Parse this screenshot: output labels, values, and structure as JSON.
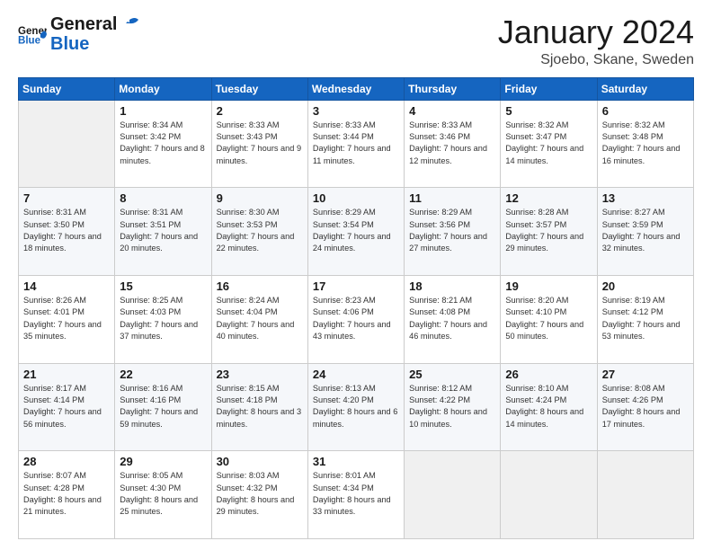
{
  "header": {
    "logo_line1": "General",
    "logo_line2": "Blue",
    "title": "January 2024",
    "subtitle": "Sjoebo, Skane, Sweden"
  },
  "days_of_week": [
    "Sunday",
    "Monday",
    "Tuesday",
    "Wednesday",
    "Thursday",
    "Friday",
    "Saturday"
  ],
  "weeks": [
    [
      {
        "num": "",
        "empty": true
      },
      {
        "num": "1",
        "sunrise": "8:34 AM",
        "sunset": "3:42 PM",
        "daylight": "7 hours and 8 minutes."
      },
      {
        "num": "2",
        "sunrise": "8:33 AM",
        "sunset": "3:43 PM",
        "daylight": "7 hours and 9 minutes."
      },
      {
        "num": "3",
        "sunrise": "8:33 AM",
        "sunset": "3:44 PM",
        "daylight": "7 hours and 11 minutes."
      },
      {
        "num": "4",
        "sunrise": "8:33 AM",
        "sunset": "3:46 PM",
        "daylight": "7 hours and 12 minutes."
      },
      {
        "num": "5",
        "sunrise": "8:32 AM",
        "sunset": "3:47 PM",
        "daylight": "7 hours and 14 minutes."
      },
      {
        "num": "6",
        "sunrise": "8:32 AM",
        "sunset": "3:48 PM",
        "daylight": "7 hours and 16 minutes."
      }
    ],
    [
      {
        "num": "7",
        "sunrise": "8:31 AM",
        "sunset": "3:50 PM",
        "daylight": "7 hours and 18 minutes."
      },
      {
        "num": "8",
        "sunrise": "8:31 AM",
        "sunset": "3:51 PM",
        "daylight": "7 hours and 20 minutes."
      },
      {
        "num": "9",
        "sunrise": "8:30 AM",
        "sunset": "3:53 PM",
        "daylight": "7 hours and 22 minutes."
      },
      {
        "num": "10",
        "sunrise": "8:29 AM",
        "sunset": "3:54 PM",
        "daylight": "7 hours and 24 minutes."
      },
      {
        "num": "11",
        "sunrise": "8:29 AM",
        "sunset": "3:56 PM",
        "daylight": "7 hours and 27 minutes."
      },
      {
        "num": "12",
        "sunrise": "8:28 AM",
        "sunset": "3:57 PM",
        "daylight": "7 hours and 29 minutes."
      },
      {
        "num": "13",
        "sunrise": "8:27 AM",
        "sunset": "3:59 PM",
        "daylight": "7 hours and 32 minutes."
      }
    ],
    [
      {
        "num": "14",
        "sunrise": "8:26 AM",
        "sunset": "4:01 PM",
        "daylight": "7 hours and 35 minutes."
      },
      {
        "num": "15",
        "sunrise": "8:25 AM",
        "sunset": "4:03 PM",
        "daylight": "7 hours and 37 minutes."
      },
      {
        "num": "16",
        "sunrise": "8:24 AM",
        "sunset": "4:04 PM",
        "daylight": "7 hours and 40 minutes."
      },
      {
        "num": "17",
        "sunrise": "8:23 AM",
        "sunset": "4:06 PM",
        "daylight": "7 hours and 43 minutes."
      },
      {
        "num": "18",
        "sunrise": "8:21 AM",
        "sunset": "4:08 PM",
        "daylight": "7 hours and 46 minutes."
      },
      {
        "num": "19",
        "sunrise": "8:20 AM",
        "sunset": "4:10 PM",
        "daylight": "7 hours and 50 minutes."
      },
      {
        "num": "20",
        "sunrise": "8:19 AM",
        "sunset": "4:12 PM",
        "daylight": "7 hours and 53 minutes."
      }
    ],
    [
      {
        "num": "21",
        "sunrise": "8:17 AM",
        "sunset": "4:14 PM",
        "daylight": "7 hours and 56 minutes."
      },
      {
        "num": "22",
        "sunrise": "8:16 AM",
        "sunset": "4:16 PM",
        "daylight": "7 hours and 59 minutes."
      },
      {
        "num": "23",
        "sunrise": "8:15 AM",
        "sunset": "4:18 PM",
        "daylight": "8 hours and 3 minutes."
      },
      {
        "num": "24",
        "sunrise": "8:13 AM",
        "sunset": "4:20 PM",
        "daylight": "8 hours and 6 minutes."
      },
      {
        "num": "25",
        "sunrise": "8:12 AM",
        "sunset": "4:22 PM",
        "daylight": "8 hours and 10 minutes."
      },
      {
        "num": "26",
        "sunrise": "8:10 AM",
        "sunset": "4:24 PM",
        "daylight": "8 hours and 14 minutes."
      },
      {
        "num": "27",
        "sunrise": "8:08 AM",
        "sunset": "4:26 PM",
        "daylight": "8 hours and 17 minutes."
      }
    ],
    [
      {
        "num": "28",
        "sunrise": "8:07 AM",
        "sunset": "4:28 PM",
        "daylight": "8 hours and 21 minutes."
      },
      {
        "num": "29",
        "sunrise": "8:05 AM",
        "sunset": "4:30 PM",
        "daylight": "8 hours and 25 minutes."
      },
      {
        "num": "30",
        "sunrise": "8:03 AM",
        "sunset": "4:32 PM",
        "daylight": "8 hours and 29 minutes."
      },
      {
        "num": "31",
        "sunrise": "8:01 AM",
        "sunset": "4:34 PM",
        "daylight": "8 hours and 33 minutes."
      },
      {
        "num": "",
        "empty": true
      },
      {
        "num": "",
        "empty": true
      },
      {
        "num": "",
        "empty": true
      }
    ]
  ],
  "labels": {
    "sunrise": "Sunrise:",
    "sunset": "Sunset:",
    "daylight": "Daylight:"
  }
}
